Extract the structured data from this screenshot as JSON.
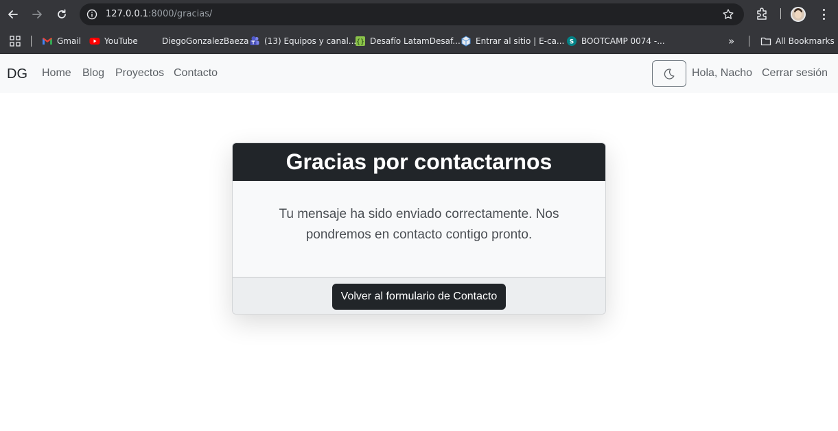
{
  "browser": {
    "url_host": "127.0.0.1",
    "url_rest": ":8000/gracias/",
    "bookmarks": [
      {
        "label": "Gmail",
        "icon": "gmail-icon"
      },
      {
        "label": "YouTube",
        "icon": "youtube-icon"
      },
      {
        "label": "DiegoGonzalezBaeza",
        "icon": "blank-icon"
      },
      {
        "label": "(13) Equipos y canal...",
        "icon": "teams-icon"
      },
      {
        "label": "Desafío LatamDesaf...",
        "icon": "desafio-icon"
      },
      {
        "label": "Entrar al sitio | E-ca...",
        "icon": "site-cube-icon"
      },
      {
        "label": "BOOTCAMP 0074 -...",
        "icon": "sharepoint-icon"
      }
    ],
    "overflow_label": "»",
    "all_bookmarks_label": "All Bookmarks"
  },
  "site": {
    "brand": "DG",
    "nav": [
      "Home",
      "Blog",
      "Proyectos",
      "Contacto"
    ],
    "greeting": "Hola, Nacho",
    "logout": "Cerrar sesión"
  },
  "card": {
    "title": "Gracias por contactarnos",
    "message": "Tu mensaje ha sido enviado correctamente. Nos pondremos en contacto contigo pronto.",
    "button": "Volver al formulario de Contacto"
  },
  "colors": {
    "chrome": "#35363a",
    "omnibox": "#202124",
    "navbar": "#f8f9fa",
    "card_header": "#212529",
    "button": "#212529"
  }
}
